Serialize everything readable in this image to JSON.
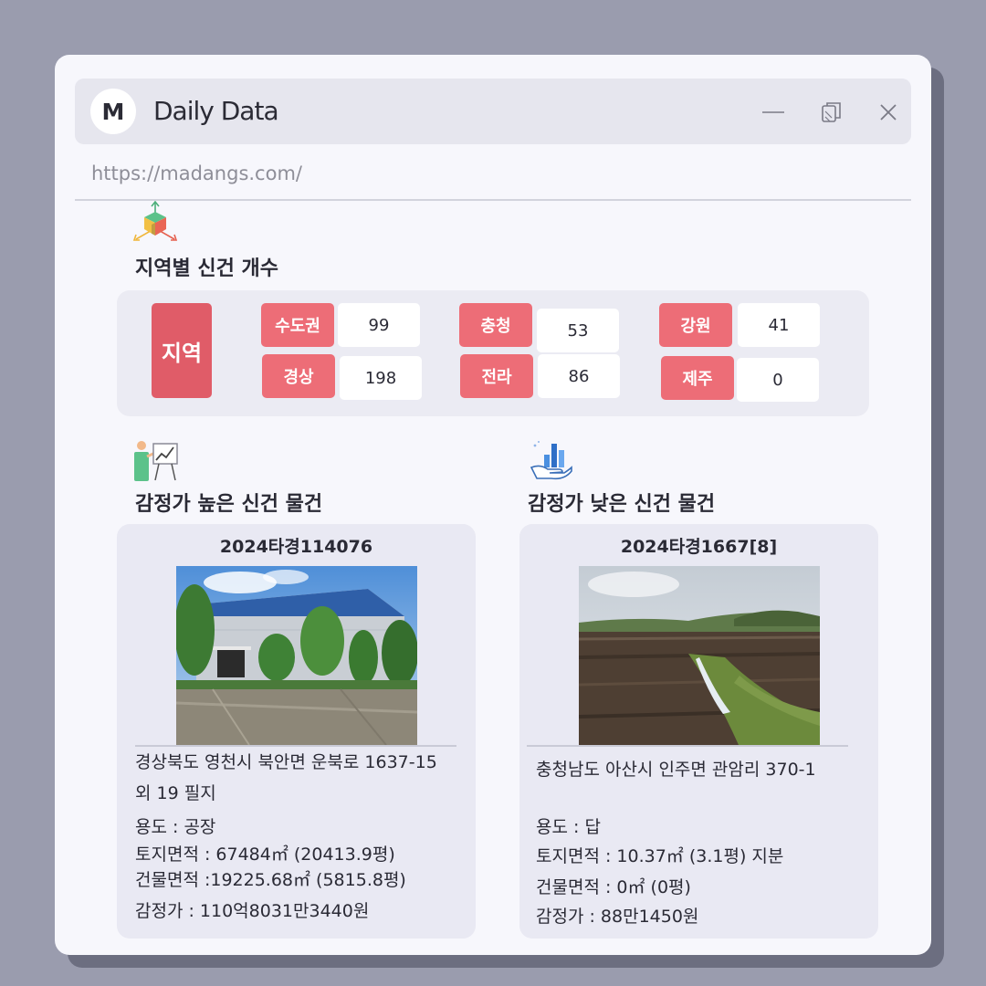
{
  "window": {
    "logo_letter": "M",
    "title": "Daily Data",
    "url": "https://madangs.com/"
  },
  "region_section": {
    "title": "지역별 신건 개수",
    "main_label": "지역",
    "regions": [
      {
        "name": "수도권",
        "count": "99"
      },
      {
        "name": "경상",
        "count": "198"
      },
      {
        "name": "충청",
        "count": "53"
      },
      {
        "name": "전라",
        "count": "86"
      },
      {
        "name": "강원",
        "count": "41"
      },
      {
        "name": "제주",
        "count": "0"
      }
    ]
  },
  "high_section": {
    "title": "감정가 높은 신건 물건",
    "case_no": "2024타경114076",
    "address": "경상북도 영천시 북안면 운북로 1637-15 외 19 필지",
    "usage": "용도 : 공장",
    "land_area": "토지면적 : 67484㎡ (20413.9평)",
    "building_area": "건물면적 :19225.68㎡ (5815.8평)",
    "appraisal": "감정가 : 110억8031만3440원"
  },
  "low_section": {
    "title": "감정가 낮은 신건 물건",
    "case_no": "2024타경1667[8]",
    "address": "충청남도 아산시 인주면 관암리 370-1",
    "usage": "용도 :  답",
    "land_area": "토지면적 : 10.37㎡ (3.1평) 지분",
    "building_area": "건물면적 : 0㎡ (0평)",
    "appraisal": "감정가 : 88만1450원"
  },
  "icons": {
    "minimize": "minimize-icon",
    "restore": "restore-icon",
    "close": "close-icon",
    "region": "cube-axes-icon",
    "high": "presenter-chart-icon",
    "low": "hand-chart-icon"
  },
  "colors": {
    "region_main": "#e05c68",
    "region_tag": "#ed6d77",
    "panel": "#ebebf3",
    "background": "#9a9cae"
  }
}
